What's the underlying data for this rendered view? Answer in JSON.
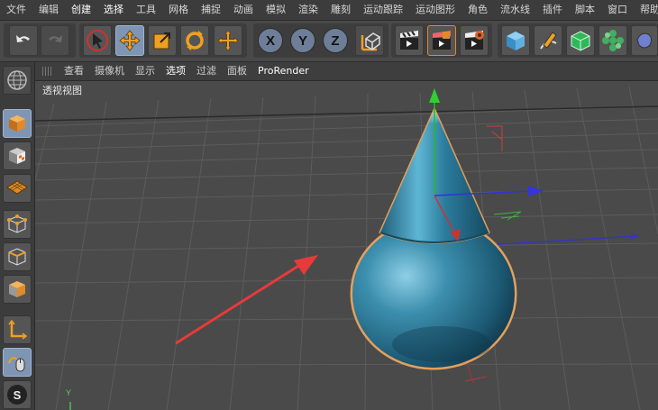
{
  "menu": [
    "文件",
    "编辑",
    "创建",
    "选择",
    "工具",
    "网格",
    "捕捉",
    "动画",
    "模拟",
    "渲染",
    "雕刻",
    "运动跟踪",
    "运动图形",
    "角色",
    "流水线",
    "插件",
    "脚本",
    "窗口",
    "帮助"
  ],
  "view_menu": [
    "查看",
    "摄像机",
    "显示",
    "选项",
    "过滤",
    "面板",
    "ProRender"
  ],
  "toolbar": {
    "x_label": "X",
    "y_label": "Y",
    "z_label": "Z"
  },
  "viewport": {
    "label": "透视视图",
    "axis_label": "Y"
  },
  "left_tools": {
    "s_label": "S"
  },
  "colors": {
    "object": "#2f7d9a",
    "highlight": "#e3a05c",
    "accent_blue": "#7f95b4",
    "arrow_red": "#e83a3a"
  },
  "icons": [
    "undo-icon",
    "redo-icon",
    "select-arrow-icon",
    "move-icon",
    "scale-icon",
    "rotate-icon",
    "live-selection-icon",
    "coordinate-icon",
    "clapper-icon",
    "render-settings-icon",
    "cube-icon",
    "pen-icon",
    "subdivision-icon",
    "cloner-icon",
    "deformer-icon",
    "model-mode-icon",
    "texture-mode-icon",
    "workplane-icon",
    "points-mode-icon",
    "edges-mode-icon",
    "polygons-mode-icon",
    "axis-mode-icon",
    "tweak-mode-icon",
    "snap-icon",
    "globe-icon"
  ]
}
